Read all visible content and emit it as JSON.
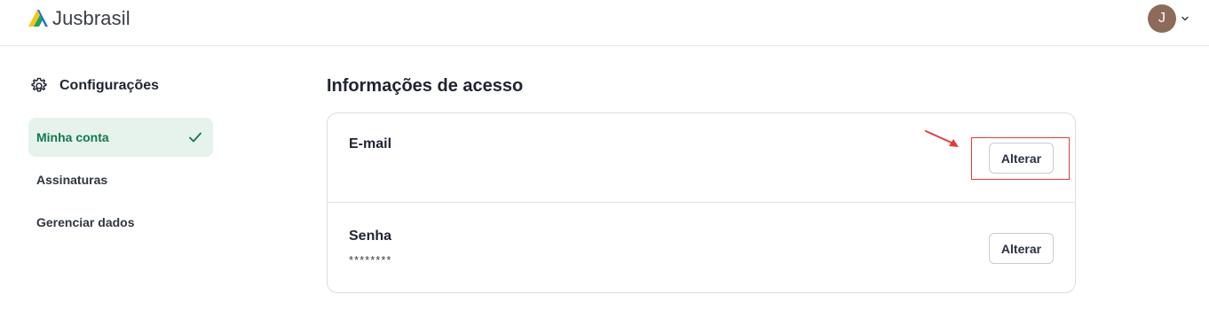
{
  "header": {
    "brand": "Jusbrasil",
    "user_initial": "J",
    "colors": {
      "logo_yellow": "#f5c518",
      "logo_green": "#1aa35c",
      "logo_blue": "#1b6fe0",
      "avatar_bg": "#8d6b5a"
    }
  },
  "sidebar": {
    "title": "Configurações",
    "items": [
      {
        "label": "Minha conta",
        "active": true
      },
      {
        "label": "Assinaturas",
        "active": false
      },
      {
        "label": "Gerenciar dados",
        "active": false
      }
    ]
  },
  "main": {
    "section_title": "Informações de acesso",
    "rows": [
      {
        "label": "E-mail",
        "value": "",
        "button": "Alterar"
      },
      {
        "label": "Senha",
        "value": "********",
        "button": "Alterar"
      }
    ]
  },
  "icons": {
    "settings": "gear-icon",
    "active_check": "check-icon",
    "avatar_menu": "chevron-down-icon"
  },
  "annotation": {
    "color": "#e23b3b"
  }
}
